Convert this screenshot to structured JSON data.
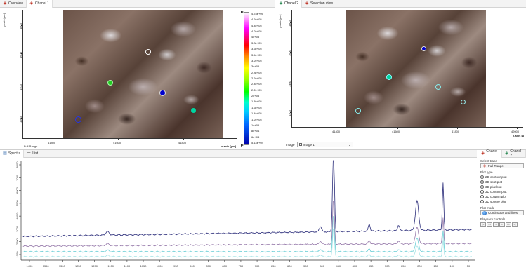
{
  "top_left": {
    "tabs": [
      {
        "label": "Overview",
        "active": false
      },
      {
        "label": "Chanel 1",
        "active": true
      }
    ],
    "y_axis_label": "y-axis [µm]",
    "y_ticks": [
      "1200",
      "1400",
      "1600",
      "1800"
    ],
    "x_ticks": [
      "41400",
      "41600",
      "41800"
    ],
    "x_axis_label": "x-axis [µm]",
    "footer_label": "Full Range",
    "markers": [
      {
        "color": "#ffffff",
        "fill": false,
        "label": "white"
      },
      {
        "color": "#22cc22",
        "fill": true,
        "label": "green"
      },
      {
        "color": "#0000cc",
        "fill": true,
        "label": "blue"
      },
      {
        "color": "#00d4a0",
        "fill": true,
        "label": "teal"
      },
      {
        "color": "#0000cc",
        "fill": false,
        "label": "blue-ring"
      }
    ],
    "colorbar_labels": [
      "4.78e+05",
      "4.6e+05",
      "4.4e+05",
      "4.2e+05",
      "4e+05",
      "3.8e+05",
      "3.6e+05",
      "3.4e+05",
      "3.2e+05",
      "3e+05",
      "2.8e+05",
      "2.6e+05",
      "2.4e+05",
      "2.2e+05",
      "2e+05",
      "1.8e+05",
      "1.6e+05",
      "1.4e+05",
      "1.2e+05",
      "1e+05",
      "8e+04",
      "6e+04",
      "5.14e+04"
    ]
  },
  "top_right": {
    "tabs": [
      {
        "label": "Chanel 2",
        "active": true
      },
      {
        "label": "Selection view",
        "active": false
      }
    ],
    "y_axis_label": "y-axis [µm]",
    "y_ticks": [
      "1200",
      "1400",
      "1600",
      "1800"
    ],
    "x_ticks": [
      "41400",
      "41600",
      "41800",
      "42000"
    ],
    "x_axis_label": "x-axis [µ",
    "image_label": "Image",
    "image_value": "Image 1"
  },
  "bottom": {
    "tabs": [
      {
        "label": "Spectra",
        "active": true
      },
      {
        "label": "List",
        "active": false
      }
    ],
    "y_ticks": [
      "1000",
      "2000",
      "3000",
      "4000",
      "5000",
      "6000",
      "7000",
      "8000"
    ],
    "x_ticks": [
      "1400",
      "1350",
      "1300",
      "1250",
      "1200",
      "1150",
      "1100",
      "1050",
      "1000",
      "950",
      "900",
      "850",
      "800",
      "750",
      "700",
      "650",
      "600",
      "550",
      "500",
      "450",
      "400",
      "350",
      "300",
      "250",
      "200",
      "150",
      "100",
      "50"
    ]
  },
  "side": {
    "tabs": [
      {
        "label": "Chanel 1",
        "active": true
      },
      {
        "label": "Chanel 2",
        "active": false
      }
    ],
    "select_trace_title": "Select trace",
    "select_trace_value": "Full Range",
    "plot_type_title": "Plot type",
    "plot_types": [
      {
        "label": "2D contour plot",
        "checked": false
      },
      {
        "label": "3D spot plot",
        "checked": true
      },
      {
        "label": "3D pixelplot",
        "checked": false
      },
      {
        "label": "3D contour plot",
        "checked": false
      },
      {
        "label": "3D column plot",
        "checked": false
      },
      {
        "label": "3D sphere plot",
        "checked": false
      }
    ],
    "plot_mode_title": "Plot mode",
    "plot_mode_value": "Continuous and lines",
    "playback_title": "Playback controls",
    "playback_buttons": [
      "|<",
      "<<",
      "<",
      ">",
      ">>",
      ">|"
    ]
  },
  "colors": {
    "spectrum_dark": "#2b2d7a",
    "spectrum_light": "#6ecfd6",
    "spectrum_mid": "#8a6aa0"
  }
}
